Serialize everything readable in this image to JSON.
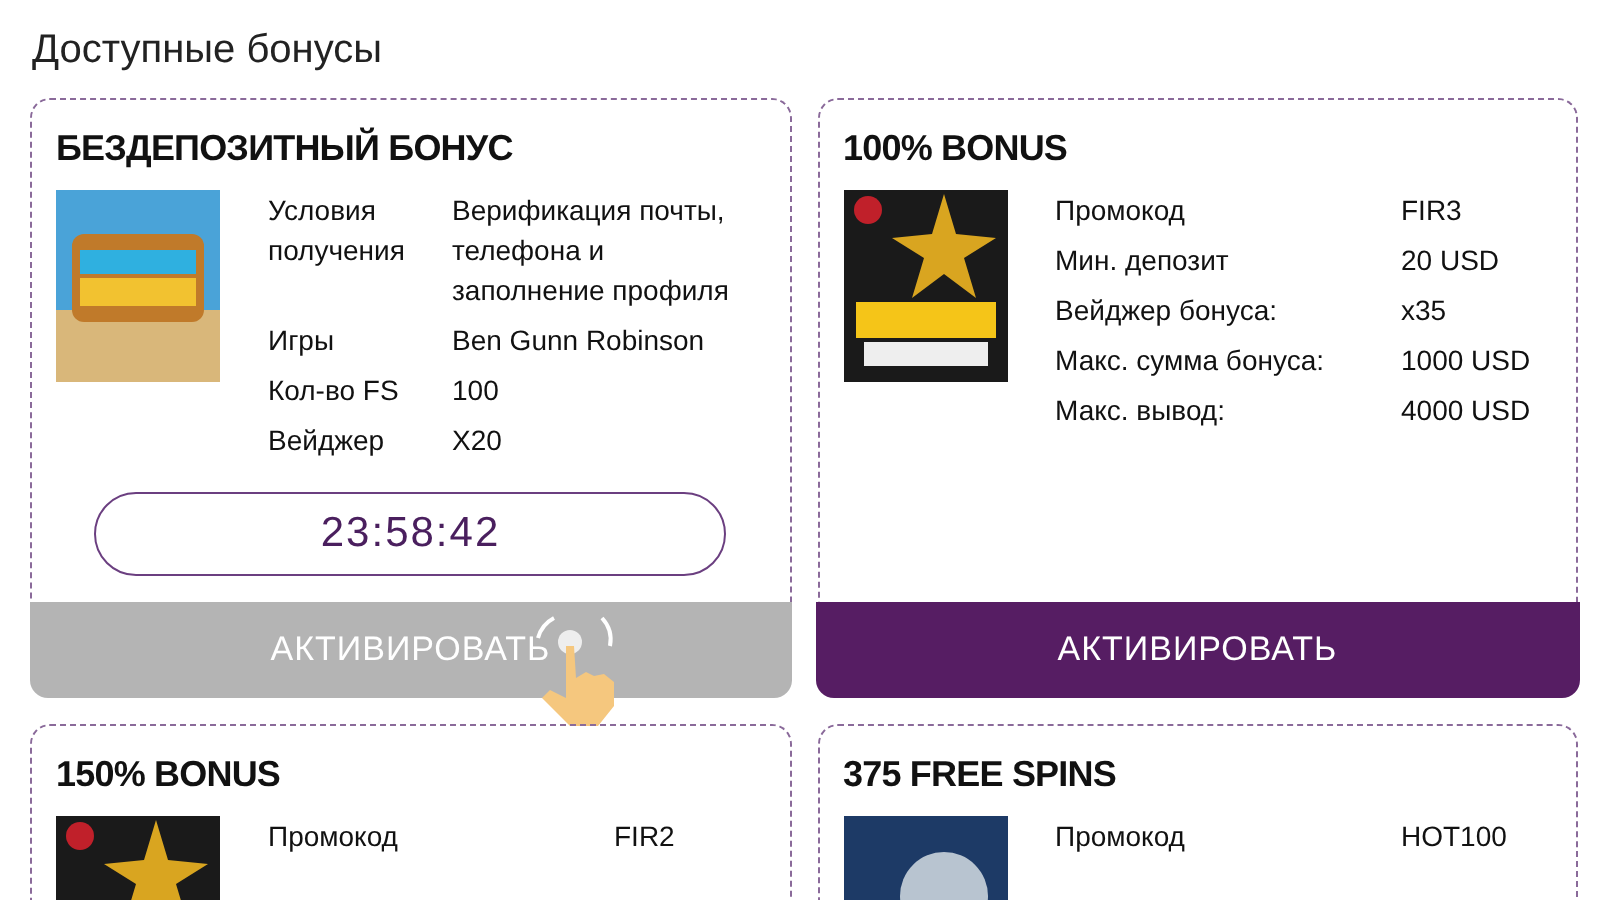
{
  "heading": "Доступные бонусы",
  "bonuses": [
    {
      "title": "БЕЗДЕПОЗИТНЫЙ БОНУС",
      "kind": "nodeposit",
      "details": [
        {
          "label": "Условия получения",
          "value": "Верификация почты, телефона и заполнение профиля"
        },
        {
          "label": "Игры",
          "value": "Ben Gunn Robinson"
        },
        {
          "label": "Кол-во FS",
          "value": "100"
        },
        {
          "label": "Вейджер",
          "value": "X20"
        }
      ],
      "timer": "23:58:42",
      "button": {
        "label": "АКТИВИРОВАТЬ",
        "disabled": true,
        "pointer": true
      }
    },
    {
      "title": "100% BONUS",
      "kind": "deposit",
      "details": [
        {
          "label": "Промокод",
          "value": "FIR3"
        },
        {
          "label": "Мин. депозит",
          "value": "20 USD"
        },
        {
          "label": "Вейджер бонуса:",
          "value": "x35"
        },
        {
          "label": "Макс. сумма бонуса:",
          "value": "1000 USD"
        },
        {
          "label": "Макс. вывод:",
          "value": "4000 USD"
        }
      ],
      "button": {
        "label": "АКТИВИРОВАТЬ",
        "disabled": false,
        "pointer": false
      }
    },
    {
      "title": "150% BONUS",
      "kind": "deposit",
      "details": [
        {
          "label": "Промокод",
          "value": "FIR2"
        }
      ]
    },
    {
      "title": "375 FREE SPINS",
      "kind": "spins",
      "details": [
        {
          "label": "Промокод",
          "value": "HOT100"
        }
      ]
    }
  ]
}
